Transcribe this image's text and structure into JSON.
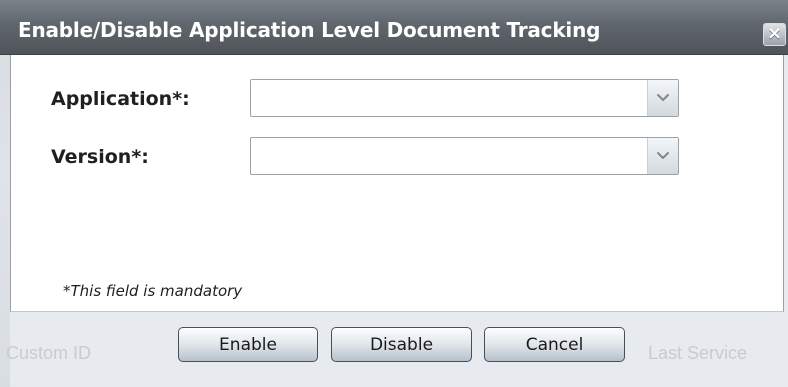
{
  "background": {
    "left_text": "Custom ID",
    "right_text": "Last Service"
  },
  "dialog": {
    "title": "Enable/Disable Application Level Document Tracking",
    "close_icon": "close-icon",
    "fields": [
      {
        "label": "Application*:",
        "value": ""
      },
      {
        "label": "Version*:",
        "value": ""
      }
    ],
    "mandatory_note": "*This field is mandatory",
    "buttons": {
      "enable": "Enable",
      "disable": "Disable",
      "cancel": "Cancel"
    }
  },
  "colors": {
    "titlebar": "#5f656c",
    "panel": "#ffffff",
    "button_border": "#46505a"
  }
}
